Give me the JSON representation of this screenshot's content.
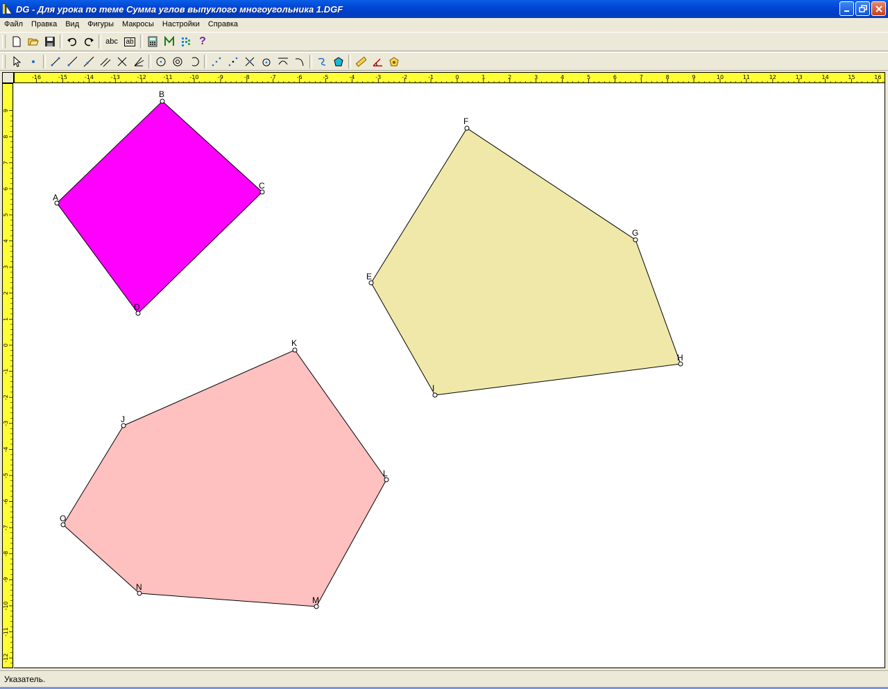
{
  "window": {
    "title": "DG - Для урока по теме Сумма углов выпуклого многоугольника 1.DGF",
    "buttons": [
      "minimize",
      "restore",
      "close"
    ]
  },
  "menu": [
    "Файл",
    "Правка",
    "Вид",
    "Фигуры",
    "Макросы",
    "Настройки",
    "Справка"
  ],
  "toolbar1": {
    "text_tool_label": "abc",
    "ab_tool_label": "ab",
    "help_label": "?"
  },
  "ruler": {
    "x_ticks": [
      "-16",
      "-15",
      "-14",
      "-13",
      "-12",
      "-11",
      "-10",
      "-9",
      "-8",
      "-7",
      "-6",
      "-5",
      "-4",
      "-3",
      "-2",
      "-1",
      "0",
      "1",
      "2",
      "3",
      "4",
      "5",
      "6",
      "7",
      "8",
      "9",
      "10",
      "11",
      "12",
      "13",
      "14",
      "15",
      "16"
    ],
    "y_ticks": [
      "9",
      "8",
      "7",
      "6",
      "5",
      "4",
      "3",
      "2",
      "1",
      "0",
      "-1",
      "-2",
      "-3",
      "-4",
      "-5",
      "-6",
      "-7",
      "-8",
      "-9",
      "-10",
      "-11",
      "-12"
    ]
  },
  "shapes": [
    {
      "name": "ABCD",
      "color": "#ff00ff",
      "points": [
        "A",
        "B",
        "C",
        "D"
      ]
    },
    {
      "name": "EFGHI",
      "color": "#f0e8a8",
      "points": [
        "E",
        "F",
        "G",
        "H",
        "I"
      ]
    },
    {
      "name": "JKLMNO",
      "color": "#ffc0c0",
      "points": [
        "J",
        "K",
        "L",
        "M",
        "N",
        "O"
      ]
    }
  ],
  "point_labels": {
    "A": "A",
    "B": "B",
    "C": "C",
    "D": "D",
    "E": "E",
    "F": "F",
    "G": "G",
    "H": "H",
    "I": "I",
    "J": "J",
    "K": "K",
    "L": "L",
    "M": "M",
    "N": "N",
    "O": "O"
  },
  "status": "Указатель."
}
